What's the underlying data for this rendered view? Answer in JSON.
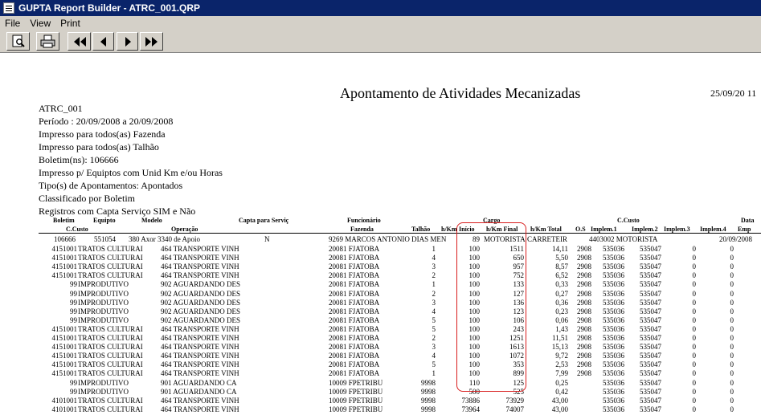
{
  "window": {
    "title": "GUPTA Report Builder - ATRC_001.QRP"
  },
  "menu": {
    "file": "File",
    "view": "View",
    "print": "Print"
  },
  "report": {
    "title": "Apontamento de Atividades Mecanizadas",
    "date": "25/09/20  11",
    "header_lines": [
      "ATRC_001",
      "Período : 20/09/2008 a 20/09/2008",
      "Impresso para todos(as) Fazenda",
      "Impresso para todos(as) Talhão",
      "Boletim(ns): 106666",
      "Impresso p/ Equiptos com Unid Km e/ou Horas",
      "Tipo(s) de Apontamentos: Apontados",
      "Classificado por Boletim",
      "Registros com Capta Serviço SIM e Não"
    ],
    "columns_row1": {
      "boletim": "Boletim",
      "equipto": "Equipto",
      "modelo": "Modelo",
      "capta": "Capta para Serviç",
      "funcionario": "Funcionário",
      "cargo": "Cargo",
      "ccusto": "C.Custo",
      "data": "Data"
    },
    "columns_row2": {
      "ccusto": "C.Custo",
      "operacao": "Operação",
      "fazenda": "Fazenda",
      "talhao": "Talhão",
      "hkm": "h/Km",
      "inicio": "Início",
      "final": "h/Km Final",
      "total": "h/Km Total",
      "os": "O.S",
      "impl1": "Implem.1",
      "impl2": "Implem.2",
      "impl3": "Implem.3",
      "impl4": "Implem.4",
      "emp": "Emp"
    },
    "boletim_row": {
      "boletim": "106666",
      "equipto": "551054",
      "modelo": "380 Axor 3340 de Apoio",
      "capta": "N",
      "funcionario": "9269 MARCOS ANTONIO DIAS MEN",
      "cargo_code": "89",
      "cargo": "MOTORISTA",
      "cargo2": "CARRETEIR",
      "ccusto": "4403002 MOTORISTA",
      "data": "20/09/2008"
    },
    "rows": [
      {
        "cc": "4151001",
        "op_desc": "TRATOS CULTURAI",
        "op": "464 TRANSPORTE VINH",
        "faz": "20081 FJATOBA",
        "tal": "1",
        "ini": "100",
        "fin": "1511",
        "tot": "14,11",
        "os": "2908",
        "i1": "535036",
        "i2": "535047",
        "i3": "0",
        "i4": "0"
      },
      {
        "cc": "4151001",
        "op_desc": "TRATOS CULTURAI",
        "op": "464 TRANSPORTE VINH",
        "faz": "20081 FJATOBA",
        "tal": "4",
        "ini": "100",
        "fin": "650",
        "tot": "5,50",
        "os": "2908",
        "i1": "535036",
        "i2": "535047",
        "i3": "0",
        "i4": "0"
      },
      {
        "cc": "4151001",
        "op_desc": "TRATOS CULTURAI",
        "op": "464 TRANSPORTE VINH",
        "faz": "20081 FJATOBA",
        "tal": "3",
        "ini": "100",
        "fin": "957",
        "tot": "8,57",
        "os": "2908",
        "i1": "535036",
        "i2": "535047",
        "i3": "0",
        "i4": "0"
      },
      {
        "cc": "4151001",
        "op_desc": "TRATOS CULTURAI",
        "op": "464 TRANSPORTE VINH",
        "faz": "20081 FJATOBA",
        "tal": "2",
        "ini": "100",
        "fin": "752",
        "tot": "6,52",
        "os": "2908",
        "i1": "535036",
        "i2": "535047",
        "i3": "0",
        "i4": "0"
      },
      {
        "cc": "99",
        "op_desc": "IMPRODUTIVO",
        "op": "902 AGUARDANDO DES",
        "faz": "20081 FJATOBA",
        "tal": "1",
        "ini": "100",
        "fin": "133",
        "tot": "0,33",
        "os": "2908",
        "i1": "535036",
        "i2": "535047",
        "i3": "0",
        "i4": "0"
      },
      {
        "cc": "99",
        "op_desc": "IMPRODUTIVO",
        "op": "902 AGUARDANDO DES",
        "faz": "20081 FJATOBA",
        "tal": "2",
        "ini": "100",
        "fin": "127",
        "tot": "0,27",
        "os": "2908",
        "i1": "535036",
        "i2": "535047",
        "i3": "0",
        "i4": "0"
      },
      {
        "cc": "99",
        "op_desc": "IMPRODUTIVO",
        "op": "902 AGUARDANDO DES",
        "faz": "20081 FJATOBA",
        "tal": "3",
        "ini": "100",
        "fin": "136",
        "tot": "0,36",
        "os": "2908",
        "i1": "535036",
        "i2": "535047",
        "i3": "0",
        "i4": "0"
      },
      {
        "cc": "99",
        "op_desc": "IMPRODUTIVO",
        "op": "902 AGUARDANDO DES",
        "faz": "20081 FJATOBA",
        "tal": "4",
        "ini": "100",
        "fin": "123",
        "tot": "0,23",
        "os": "2908",
        "i1": "535036",
        "i2": "535047",
        "i3": "0",
        "i4": "0"
      },
      {
        "cc": "99",
        "op_desc": "IMPRODUTIVO",
        "op": "902 AGUARDANDO DES",
        "faz": "20081 FJATOBA",
        "tal": "5",
        "ini": "100",
        "fin": "106",
        "tot": "0,06",
        "os": "2908",
        "i1": "535036",
        "i2": "535047",
        "i3": "0",
        "i4": "0"
      },
      {
        "cc": "4151001",
        "op_desc": "TRATOS CULTURAI",
        "op": "464 TRANSPORTE VINH",
        "faz": "20081 FJATOBA",
        "tal": "5",
        "ini": "100",
        "fin": "243",
        "tot": "1,43",
        "os": "2908",
        "i1": "535036",
        "i2": "535047",
        "i3": "0",
        "i4": "0"
      },
      {
        "cc": "4151001",
        "op_desc": "TRATOS CULTURAI",
        "op": "464 TRANSPORTE VINH",
        "faz": "20081 FJATOBA",
        "tal": "2",
        "ini": "100",
        "fin": "1251",
        "tot": "11,51",
        "os": "2908",
        "i1": "535036",
        "i2": "535047",
        "i3": "0",
        "i4": "0"
      },
      {
        "cc": "4151001",
        "op_desc": "TRATOS CULTURAI",
        "op": "464 TRANSPORTE VINH",
        "faz": "20081 FJATOBA",
        "tal": "3",
        "ini": "100",
        "fin": "1613",
        "tot": "15,13",
        "os": "2908",
        "i1": "535036",
        "i2": "535047",
        "i3": "0",
        "i4": "0"
      },
      {
        "cc": "4151001",
        "op_desc": "TRATOS CULTURAI",
        "op": "464 TRANSPORTE VINH",
        "faz": "20081 FJATOBA",
        "tal": "4",
        "ini": "100",
        "fin": "1072",
        "tot": "9,72",
        "os": "2908",
        "i1": "535036",
        "i2": "535047",
        "i3": "0",
        "i4": "0"
      },
      {
        "cc": "4151001",
        "op_desc": "TRATOS CULTURAI",
        "op": "464 TRANSPORTE VINH",
        "faz": "20081 FJATOBA",
        "tal": "5",
        "ini": "100",
        "fin": "353",
        "tot": "2,53",
        "os": "2908",
        "i1": "535036",
        "i2": "535047",
        "i3": "0",
        "i4": "0"
      },
      {
        "cc": "4151001",
        "op_desc": "TRATOS CULTURAI",
        "op": "464 TRANSPORTE VINH",
        "faz": "20081 FJATOBA",
        "tal": "1",
        "ini": "100",
        "fin": "899",
        "tot": "7,99",
        "os": "2908",
        "i1": "535036",
        "i2": "535047",
        "i3": "0",
        "i4": "0"
      },
      {
        "cc": "99",
        "op_desc": "IMPRODUTIVO",
        "op": "901 AGUARDANDO CA",
        "faz": "10009 FPETRIBU",
        "tal": "9998",
        "ini": "110",
        "fin": "125",
        "tot": "0,25",
        "os": "",
        "i1": "535036",
        "i2": "535047",
        "i3": "0",
        "i4": "0"
      },
      {
        "cc": "99",
        "op_desc": "IMPRODUTIVO",
        "op": "901 AGUARDANDO CA",
        "faz": "10009 FPETRIBU",
        "tal": "9998",
        "ini": "500",
        "fin": "525",
        "tot": "0,42",
        "os": "",
        "i1": "535036",
        "i2": "535047",
        "i3": "0",
        "i4": "0"
      },
      {
        "cc": "4101001",
        "op_desc": "TRATOS CULTURAI",
        "op": "464 TRANSPORTE VINH",
        "faz": "10009 FPETRIBU",
        "tal": "9998",
        "ini": "73886",
        "fin": "73929",
        "tot": "43,00",
        "os": "",
        "i1": "535036",
        "i2": "535047",
        "i3": "0",
        "i4": "0"
      },
      {
        "cc": "4101001",
        "op_desc": "TRATOS CULTURAI",
        "op": "464 TRANSPORTE VINH",
        "faz": "10009 FPETRIBU",
        "tal": "9998",
        "ini": "73964",
        "fin": "74007",
        "tot": "43,00",
        "os": "",
        "i1": "535036",
        "i2": "535047",
        "i3": "0",
        "i4": "0"
      }
    ]
  }
}
